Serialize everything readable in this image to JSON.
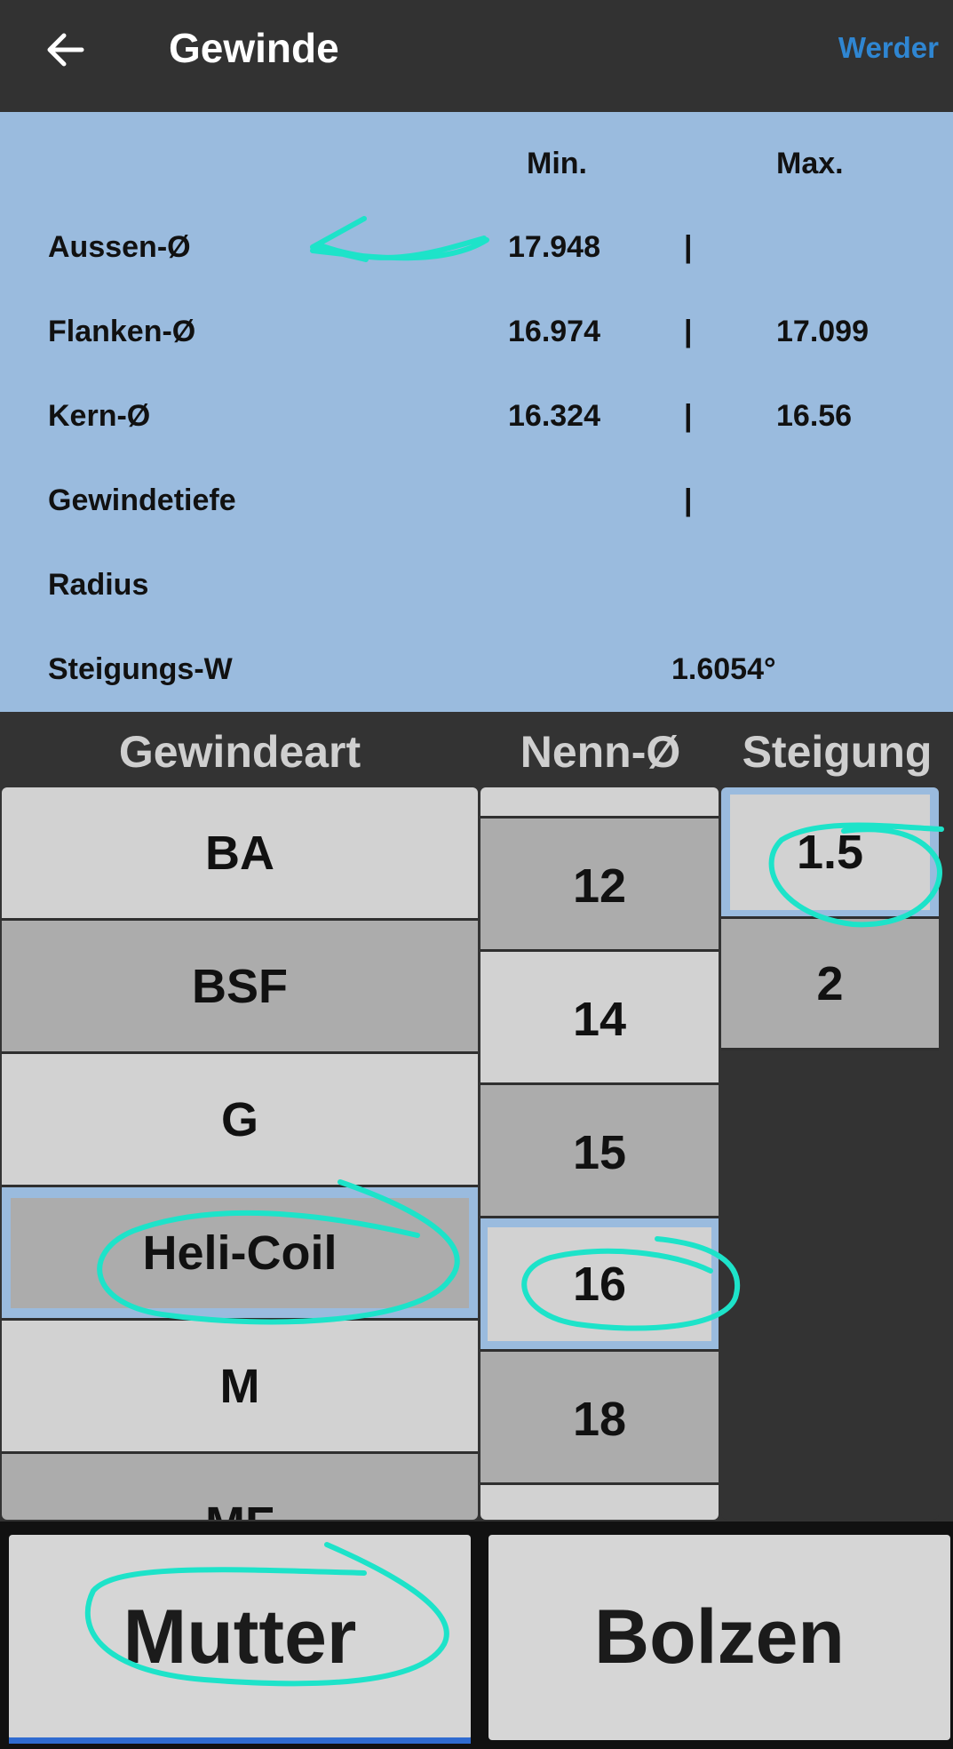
{
  "appbar": {
    "title": "Gewinde",
    "brand": "Werder"
  },
  "results": {
    "header_min": "Min.",
    "header_max": "Max.",
    "rows": [
      {
        "label": "Aussen-Ø",
        "min": "17.948",
        "sep": "|",
        "max": ""
      },
      {
        "label": "Flanken-Ø",
        "min": "16.974",
        "sep": "|",
        "max": "17.099"
      },
      {
        "label": "Kern-Ø",
        "min": "16.324",
        "sep": "|",
        "max": "16.56"
      },
      {
        "label": "Gewindetiefe",
        "min": "",
        "sep": "|",
        "max": ""
      },
      {
        "label": "Radius",
        "min": "",
        "sep": "",
        "max": ""
      },
      {
        "label": "Steigungs-W",
        "value": "1.6054°"
      }
    ]
  },
  "pickers": {
    "gewindeart": {
      "header": "Gewindeart",
      "items": [
        "BA",
        "BSF",
        "G",
        "Heli-Coil",
        "M",
        "MF"
      ],
      "selected": "Heli-Coil"
    },
    "nenn": {
      "header": "Nenn-Ø",
      "items": [
        "12",
        "14",
        "15",
        "16",
        "18"
      ],
      "selected": "16"
    },
    "steigung": {
      "header": "Steigung",
      "items": [
        "1.5",
        "2"
      ],
      "selected": "1.5"
    }
  },
  "buttons": {
    "mutter": "Mutter",
    "bolzen": "Bolzen",
    "active": "Mutter"
  },
  "colors": {
    "appbar": "#323232",
    "brand": "#2f86d2",
    "results_bg": "#9abbde",
    "annotation": "#1de3c9",
    "accent": "#2f6bd0"
  }
}
